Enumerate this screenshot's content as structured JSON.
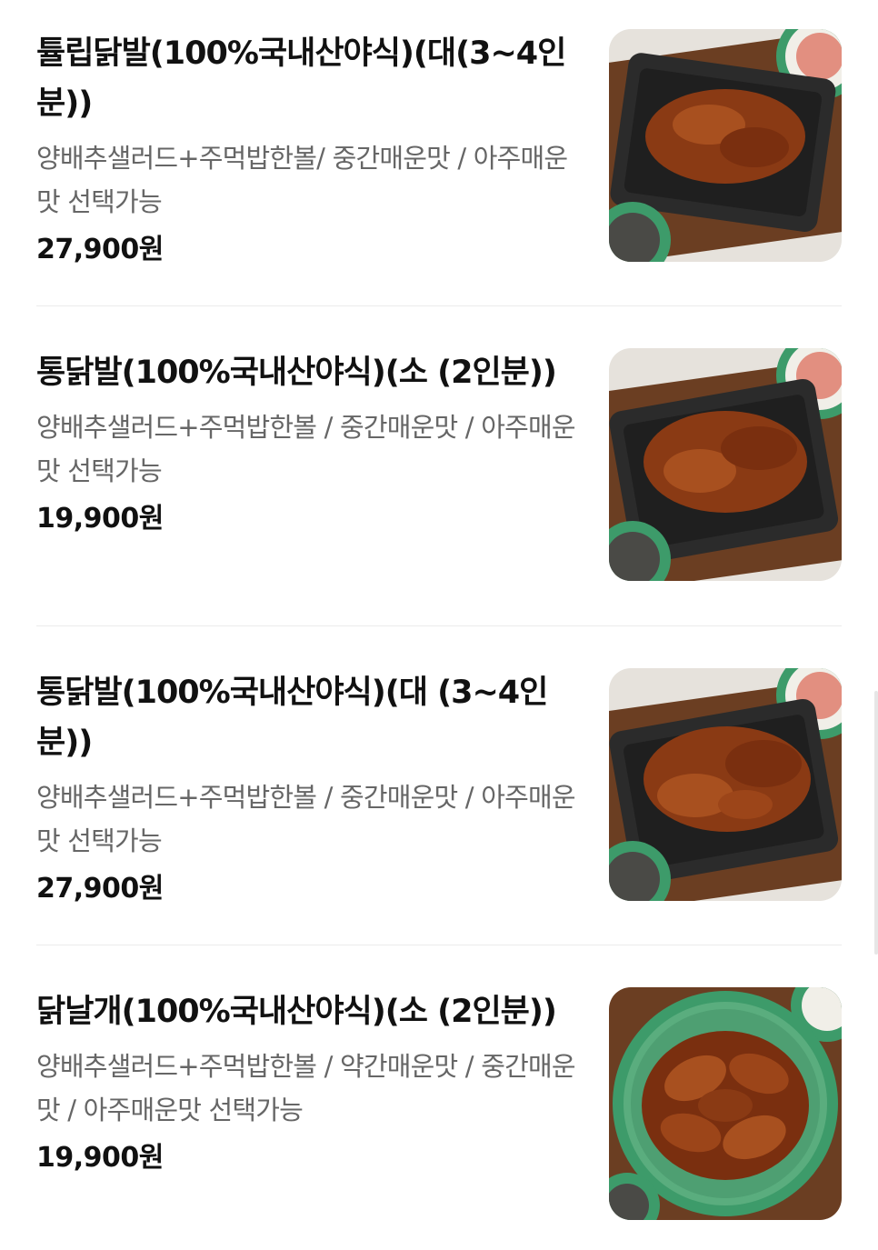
{
  "menu": {
    "items": [
      {
        "name": "튤립닭발(100%국내산야식)(대(3~4인분))",
        "description": "양배추샐러드+주먹밥한볼/ 중간매운맛 / 아주매운맛 선택가능",
        "price": "27,900원",
        "image": "grilled-chicken-feet-photo"
      },
      {
        "name": "통닭발(100%국내산야식)(소 (2인분))",
        "description": "양배추샐러드+주먹밥한볼 / 중간매운맛 / 아주매운맛 선택가능",
        "price": "19,900원",
        "image": "grilled-chicken-feet-photo"
      },
      {
        "name": "통닭발(100%국내산야식)(대 (3~4인분))",
        "description": "양배추샐러드+주먹밥한볼 / 중간매운맛 / 아주매운맛 선택가능",
        "price": "27,900원",
        "image": "grilled-chicken-feet-photo"
      },
      {
        "name": "닭날개(100%국내산야식)(소 (2인분))",
        "description": "양배추샐러드+주먹밥한볼 / 약간매운맛 / 중간매운맛 / 아주매운맛 선택가능",
        "price": "19,900원",
        "image": "spicy-chicken-wings-photo"
      }
    ]
  },
  "colors": {
    "title": "#111111",
    "description": "#666666",
    "divider": "#ececec",
    "plate_green": "#3d9b6a",
    "sauce_brown": "#8a3a14"
  }
}
